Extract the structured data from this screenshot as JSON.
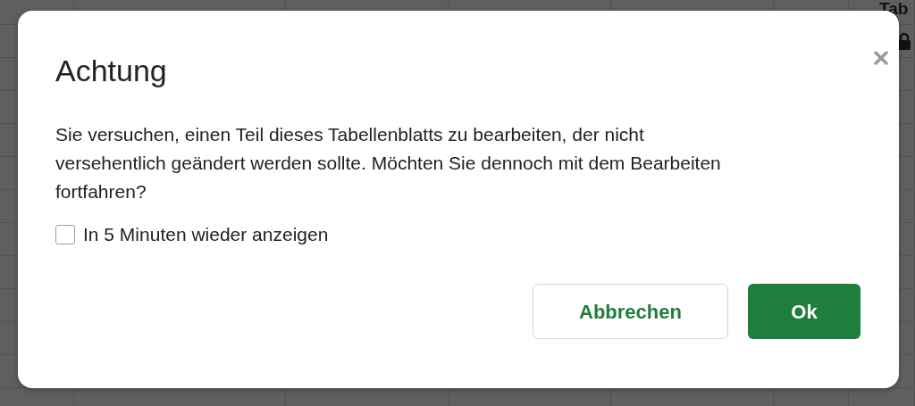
{
  "background": {
    "corner_text": "Tab"
  },
  "dialog": {
    "title": "Achtung",
    "message": "Sie versuchen, einen Teil dieses Tabellenblatts zu bearbeiten, der nicht versehentlich geändert werden sollte. Möchten Sie dennoch mit dem Bearbeiten fortfahren?",
    "checkbox": {
      "label": "In 5 Minuten wieder anzeigen",
      "checked": false
    },
    "buttons": [
      {
        "label": "Abbrechen",
        "kind": "secondary"
      },
      {
        "label": "Ok",
        "kind": "primary"
      }
    ]
  }
}
